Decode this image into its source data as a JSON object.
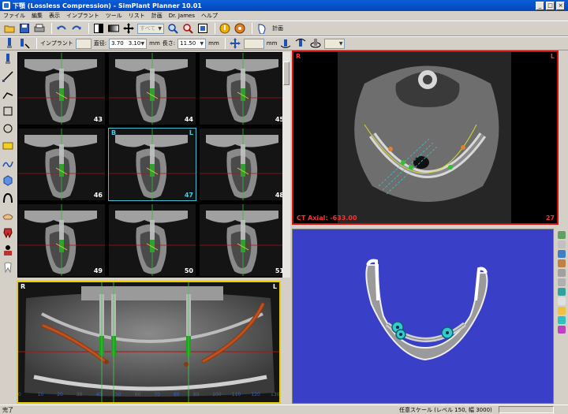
{
  "window": {
    "title": "下顎 (Lossless Compression) - SimPlant Planner 10.01",
    "controls": [
      "_",
      "□",
      "×"
    ]
  },
  "menu": [
    "ファイル",
    "編集",
    "表示",
    "インプラント",
    "ツール",
    "リスト",
    "計画",
    "Dr. James",
    "ヘルプ"
  ],
  "toolbar1": {
    "keisan_label": "計画",
    "icons": [
      "open-icon",
      "save-icon",
      "print-icon",
      "undo-icon",
      "redo-icon",
      "contrast-icon",
      "window-level-icon",
      "pan-icon",
      "zoom-combo",
      "zoom-in-icon",
      "zoom-out-icon",
      "fit-icon",
      "info-icon",
      "measure-icon",
      "plan-icon"
    ],
    "zoom_value": "すべて"
  },
  "toolbar2": {
    "implant_label": "インプラント",
    "implant_value": "",
    "diameter_label": "直径:",
    "diameter_value": "3.70",
    "diameter_max": "3.10",
    "diameter_unit": "mm",
    "length_label": "長さ:",
    "length_value": "11.50",
    "length_unit": "mm",
    "offset_value": "",
    "offset_unit": "mm"
  },
  "slices": [
    {
      "num": "43"
    },
    {
      "num": "44"
    },
    {
      "num": "45"
    },
    {
      "num": "46"
    },
    {
      "num": "47",
      "active": true,
      "tag_left": "B",
      "tag_right": "L"
    },
    {
      "num": "48"
    },
    {
      "num": "49"
    },
    {
      "num": "50"
    },
    {
      "num": "51"
    }
  ],
  "panoramic": {
    "corner_left": "R",
    "corner_right": "L",
    "scale": [
      "0",
      "10",
      "20",
      "30",
      "40",
      "50",
      "60",
      "70",
      "80",
      "90",
      "100",
      "110",
      "120",
      "130"
    ]
  },
  "axial": {
    "corner_left": "R",
    "corner_right": "L",
    "footer": "CT Axial: -633.00",
    "slice_num": "27"
  },
  "status": {
    "left": "完了",
    "right": "任意スケール (レベル 150, 幅 3000)"
  },
  "colors": {
    "accent_red": "#d01010",
    "pano_border": "#e8d000",
    "active_slice": "#40c0d0",
    "background_3d": "#3a3fc8"
  }
}
